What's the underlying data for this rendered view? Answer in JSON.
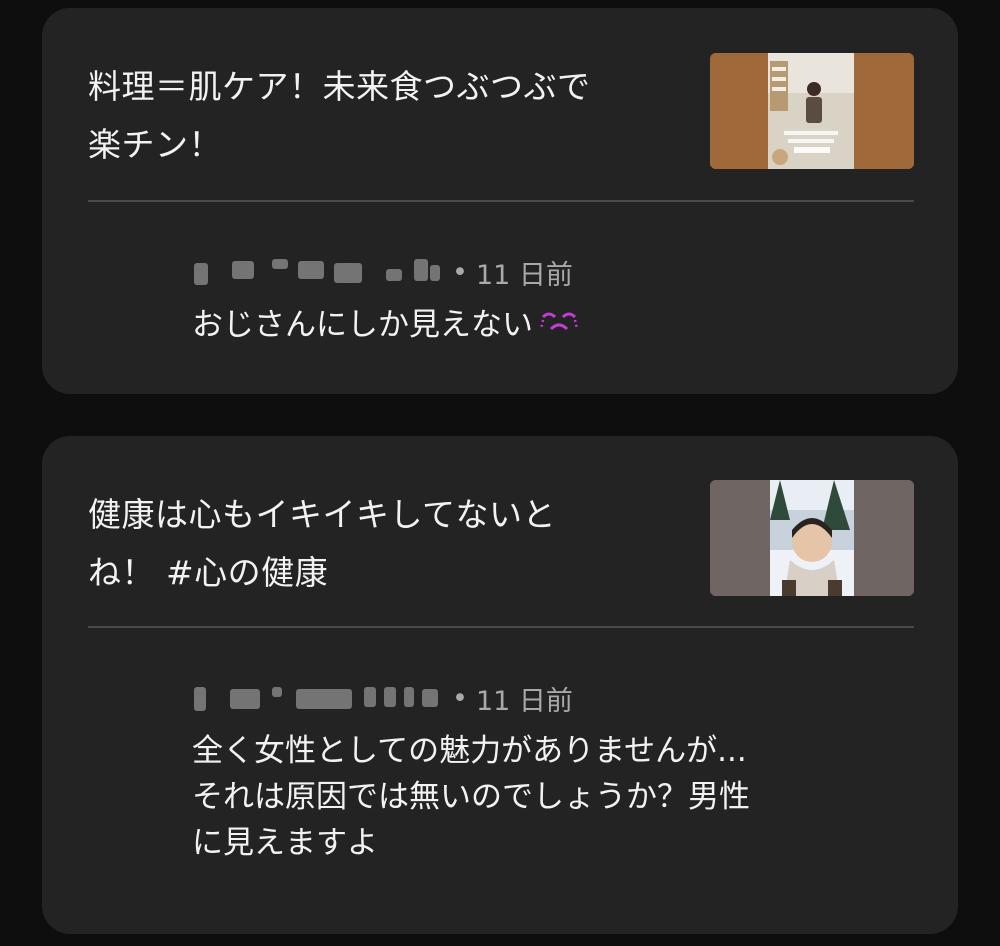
{
  "cards": [
    {
      "title": "料理＝肌ケア！未来食つぶつぶで\n楽チン！",
      "comment": {
        "time": "11 日前",
        "text": "おじさんにしか見えない",
        "emoji": "crying-face-icon"
      }
    },
    {
      "title": "健康は心もイキイキしてないと\nね！ #心の健康",
      "comment": {
        "time": "11 日前",
        "text": "全く女性としての魅力がありませんが...\nそれは原因では無いのでしょうか？男性\nに見えますよ"
      }
    }
  ],
  "meta_separator": "•",
  "colors": {
    "background": "#0e0e0f",
    "card": "#232323",
    "text_primary": "#f2f2f2",
    "text_secondary": "#a9a9a9",
    "emoji_accent": "#c43bd6"
  }
}
